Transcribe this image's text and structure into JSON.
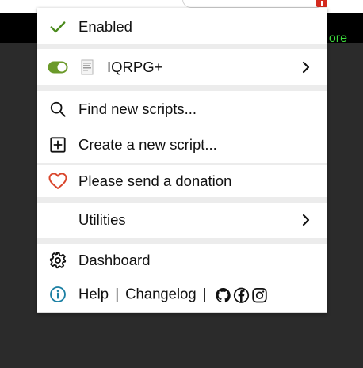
{
  "site": {
    "header_text": "ore"
  },
  "menu": {
    "enabled": {
      "label": "Enabled",
      "icon": "check-icon"
    },
    "script": {
      "name": "IQRPG+",
      "icon": "toggle-icon",
      "favicon": "page-icon"
    },
    "find_scripts": {
      "label": "Find new scripts...",
      "icon": "search-icon"
    },
    "create_script": {
      "label": "Create a new script...",
      "icon": "plus-box-icon"
    },
    "donation": {
      "label": "Please send a donation",
      "icon": "heart-icon"
    },
    "utilities": {
      "label": "Utilities"
    },
    "dashboard": {
      "label": "Dashboard",
      "icon": "gear-icon"
    },
    "help": {
      "help_label": "Help",
      "separator": "|",
      "changelog_label": "Changelog",
      "icons": [
        "github-icon",
        "facebook-icon",
        "instagram-icon"
      ]
    }
  },
  "colors": {
    "check": "#4a8a1c",
    "toggle_on": "#6b9a2a",
    "heart": "#d9452b",
    "info": "#1a7fa3",
    "site_header": "#000000",
    "accent_green": "#3ddc3d",
    "background": "#2b2b2b"
  }
}
